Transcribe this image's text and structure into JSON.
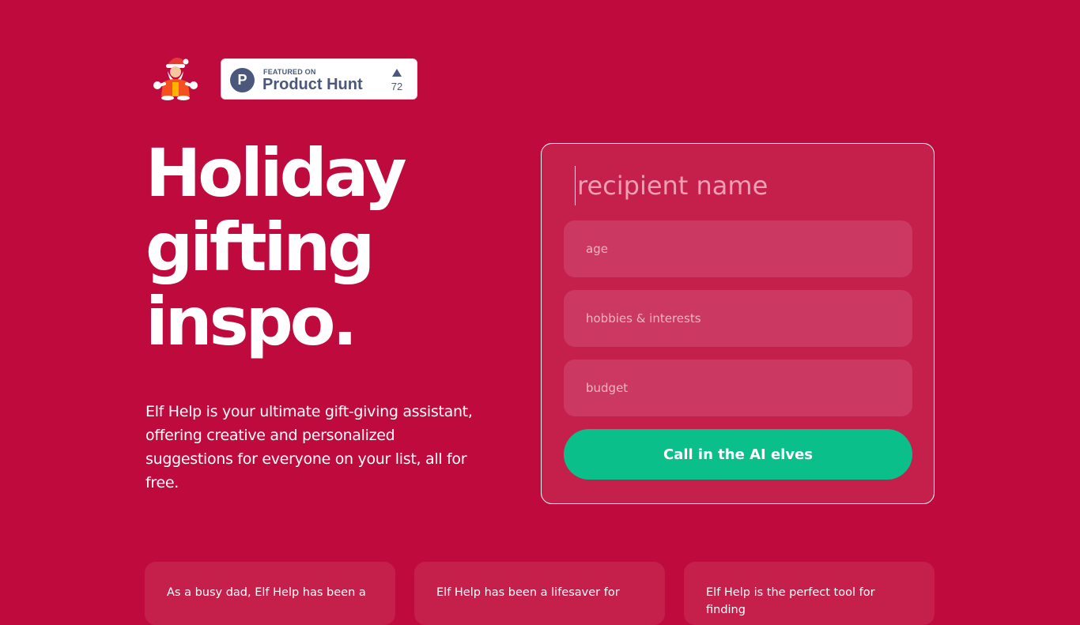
{
  "header": {
    "product_hunt": {
      "featured_label": "FEATURED ON",
      "name": "Product Hunt",
      "logo_letter": "P",
      "upvotes": "72"
    }
  },
  "hero": {
    "headline": "Holiday\ngifting\ninspo.",
    "description": "Elf Help is your ultimate gift-giving assistant, offering creative and personalized suggestions for everyone on your list, all for free."
  },
  "form": {
    "recipient_placeholder": "recipient name",
    "age_placeholder": "age",
    "hobbies_placeholder": "hobbies & interests",
    "budget_placeholder": "budget",
    "submit_label": "Call in the AI elves"
  },
  "testimonials": [
    {
      "text": "As a busy dad, Elf Help has been a"
    },
    {
      "text": "Elf Help has been a lifesaver for"
    },
    {
      "text": "Elf Help is the perfect tool for finding"
    }
  ],
  "colors": {
    "background": "#be0a3c",
    "card": "#c51f4b",
    "field": "#cb3862",
    "accent_button": "#0bbf8b",
    "product_hunt": "#4b587c"
  }
}
